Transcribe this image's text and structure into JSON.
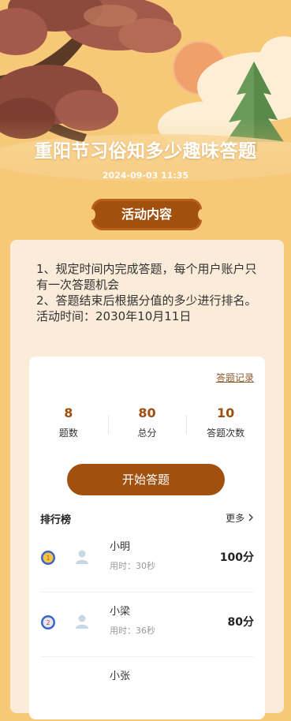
{
  "header": {
    "title": "重阳节习俗知多少趣味答题",
    "date": "2024-09-03 11:35",
    "section_label": "活动内容"
  },
  "rules": {
    "line1": "1、规定时间内完成答题，每个用户账户只有一次答题机会",
    "line2": "2、答题结束后根据分值的多少进行排名。",
    "line3": "活动时间：2030年10月11日"
  },
  "panel": {
    "record_link": "答题记录",
    "stats": [
      {
        "value": "8",
        "label": "题数"
      },
      {
        "value": "80",
        "label": "总分"
      },
      {
        "value": "10",
        "label": "答题次数"
      }
    ],
    "start_button": "开始答题",
    "ranking_title": "排行榜",
    "ranking_more": "更多",
    "ranking": [
      {
        "name": "小明",
        "time": "用时：30秒",
        "score": "100分",
        "medal": "gold"
      },
      {
        "name": "小梁",
        "time": "用时：36秒",
        "score": "80分",
        "medal": "silver"
      },
      {
        "name": "小张",
        "time": "",
        "score": "",
        "medal": "bronze"
      }
    ]
  },
  "colors": {
    "background": "#f6c878",
    "accent": "#a1500e",
    "card": "#faecd9"
  }
}
